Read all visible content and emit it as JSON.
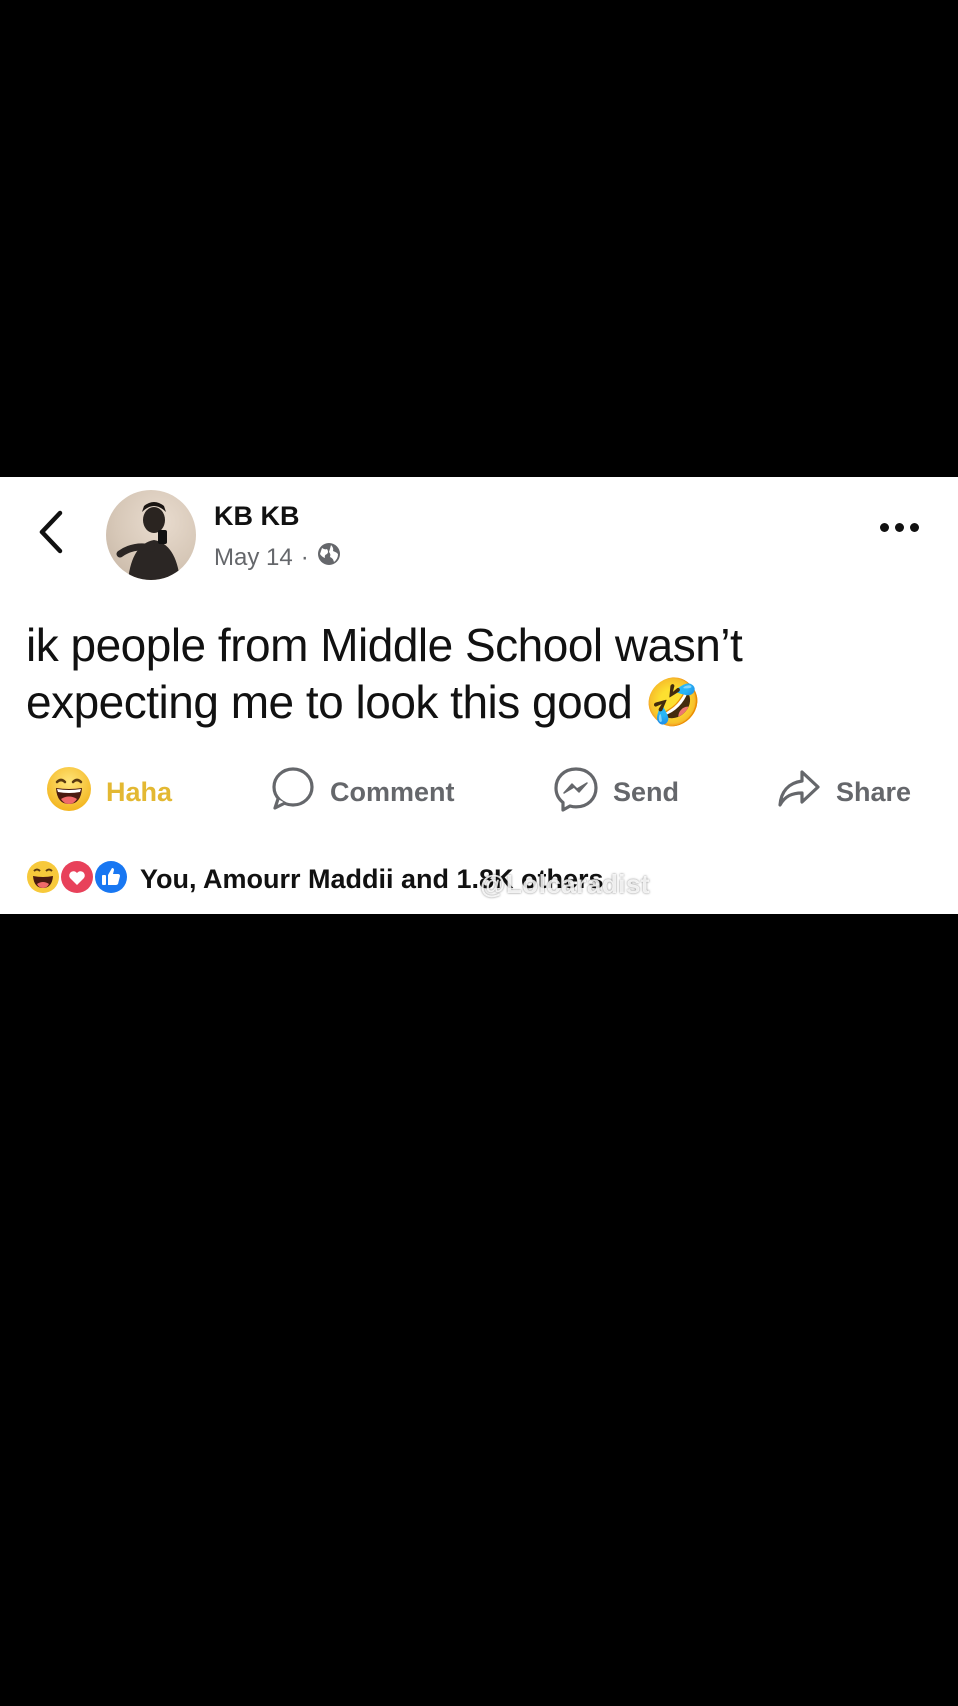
{
  "post": {
    "author": "KB KB",
    "date": "May 14",
    "separator": "·",
    "text": "ik people from Middle School wasn’t expecting me to look this good 🤣"
  },
  "actions": {
    "haha": "Haha",
    "comment": "Comment",
    "send": "Send",
    "share": "Share"
  },
  "reactions": {
    "summary": "You, Amourr Maddii and 1.8K others"
  },
  "watermark": "@Lolcaradist",
  "colors": {
    "haha_accent": "#e3b832",
    "action_gray": "#65676b",
    "love_red": "#e8415a",
    "like_blue": "#1877f2"
  },
  "icons": [
    "back-arrow-icon",
    "globe-icon",
    "more-icon",
    "haha-emoji-icon",
    "comment-icon",
    "messenger-send-icon",
    "share-arrow-icon",
    "love-reaction-icon",
    "like-reaction-icon"
  ]
}
